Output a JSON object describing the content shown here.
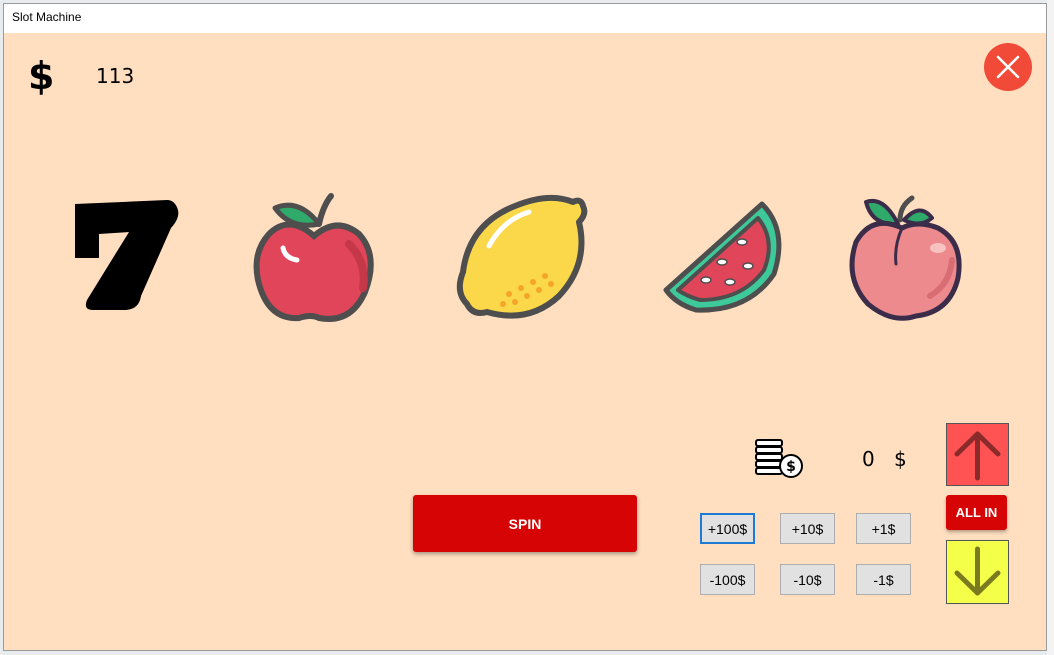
{
  "window": {
    "title": "Slot Machine"
  },
  "balance": {
    "icon": "dollar-icon",
    "symbol": "$",
    "value": "113"
  },
  "close": {
    "icon": "close-icon",
    "color": "#f14a38"
  },
  "reels": [
    {
      "symbol": "seven-icon"
    },
    {
      "symbol": "apple-icon"
    },
    {
      "symbol": "lemon-icon"
    },
    {
      "symbol": "watermelon-icon"
    },
    {
      "symbol": "peach-icon"
    }
  ],
  "spin": {
    "label": "SPIN",
    "color": "#d60404"
  },
  "bet": {
    "icon": "coins-icon",
    "amount": "0",
    "currency": "$",
    "increase_buttons": [
      "+100$",
      "+10$",
      "+1$"
    ],
    "decrease_buttons": [
      "-100$",
      "-10$",
      "-1$"
    ],
    "all_in_label": "ALL IN",
    "up_icon": "arrow-up-icon",
    "down_icon": "arrow-down-icon",
    "up_color": "#ff5252",
    "down_color": "#f4ff4a"
  }
}
